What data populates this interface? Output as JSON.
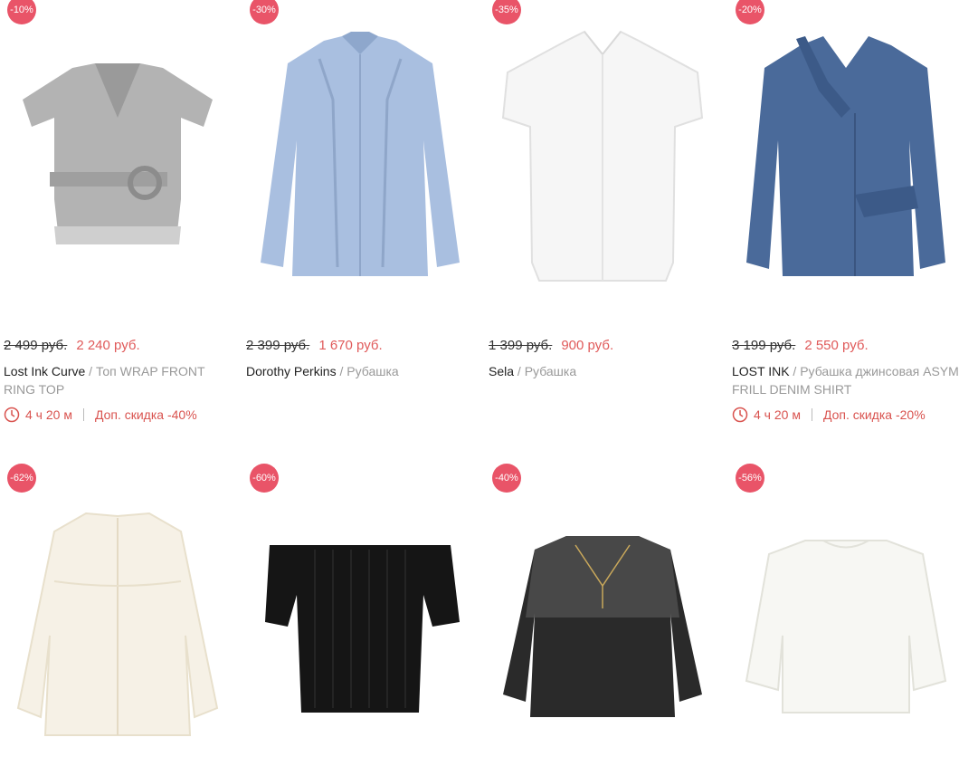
{
  "currency_label": "руб.",
  "accent_color": "#e95468",
  "products": [
    {
      "discount": "-10%",
      "old_price": "2 499 руб.",
      "new_price": "2 240 руб.",
      "brand": "Lost Ink Curve",
      "type": "Топ WRAP FRONT RING TOP",
      "timer": "4 ч 20 м",
      "extra": "Доп. скидка -40%",
      "image": "grey-wrap-top"
    },
    {
      "discount": "-30%",
      "old_price": "2 399 руб.",
      "new_price": "1 670 руб.",
      "brand": "Dorothy Perkins",
      "type": "Рубашка",
      "timer": "",
      "extra": "",
      "image": "light-blue-shirt"
    },
    {
      "discount": "-35%",
      "old_price": "1 399 руб.",
      "new_price": "900 руб.",
      "brand": "Sela",
      "type": "Рубашка",
      "timer": "",
      "extra": "",
      "image": "white-short-sleeve-shirt"
    },
    {
      "discount": "-20%",
      "old_price": "3 199 руб.",
      "new_price": "2 550 руб.",
      "brand": "LOST INK",
      "type": "Рубашка джинсовая ASYM FRILL DENIM SHIRT",
      "timer": "4 ч 20 м",
      "extra": "Доп. скидка -20%",
      "image": "denim-ruffle-shirt"
    },
    {
      "discount": "-62%",
      "image": "cream-blouse"
    },
    {
      "discount": "-60%",
      "image": "black-off-shoulder-top"
    },
    {
      "discount": "-40%",
      "image": "black-lace-top"
    },
    {
      "discount": "-56%",
      "image": "white-bell-sleeve-top"
    }
  ]
}
